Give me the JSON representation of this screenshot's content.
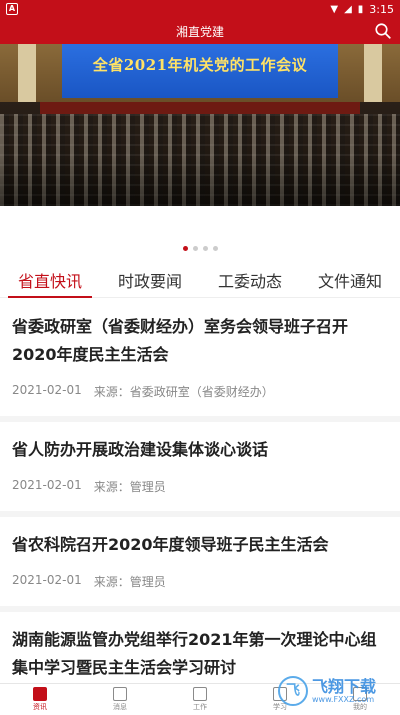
{
  "status": {
    "time": "3:15",
    "app_badge": "A"
  },
  "appbar": {
    "title": "湘直党建"
  },
  "banner": {
    "caption": "全省2021年机关党的工作会议"
  },
  "carousel": {
    "page": 1,
    "total": 4
  },
  "tabs": [
    {
      "label": "省直快讯",
      "active": true
    },
    {
      "label": "时政要闻",
      "active": false
    },
    {
      "label": "工委动态",
      "active": false
    },
    {
      "label": "文件通知",
      "active": false
    }
  ],
  "articles": [
    {
      "title": "省委政研室（省委财经办）室务会领导班子召开2020年度民主生活会",
      "date": "2021-02-01",
      "source": "来源：省委政研室（省委财经办）"
    },
    {
      "title": "省人防办开展政治建设集体谈心谈话",
      "date": "2021-02-01",
      "source": "来源：管理员"
    },
    {
      "title": "省农科院召开2020年度领导班子民主生活会",
      "date": "2021-02-01",
      "source": "来源：管理员"
    },
    {
      "title": "湖南能源监管办党组举行2021年第一次理论中心组集中学习暨民主生活会学习研讨",
      "date": "",
      "source": ""
    }
  ],
  "bottomnav": [
    {
      "label": "资讯",
      "icon": "news-icon",
      "active": true
    },
    {
      "label": "消息",
      "icon": "message-icon",
      "active": false
    },
    {
      "label": "工作",
      "icon": "work-icon",
      "active": false
    },
    {
      "label": "学习",
      "icon": "study-icon",
      "active": false
    },
    {
      "label": "我的",
      "icon": "profile-icon",
      "active": false
    }
  ],
  "watermark": {
    "text": "飞翔下载",
    "sub": "www.FXXZ.com"
  },
  "colors": {
    "brand": "#c30f19"
  }
}
